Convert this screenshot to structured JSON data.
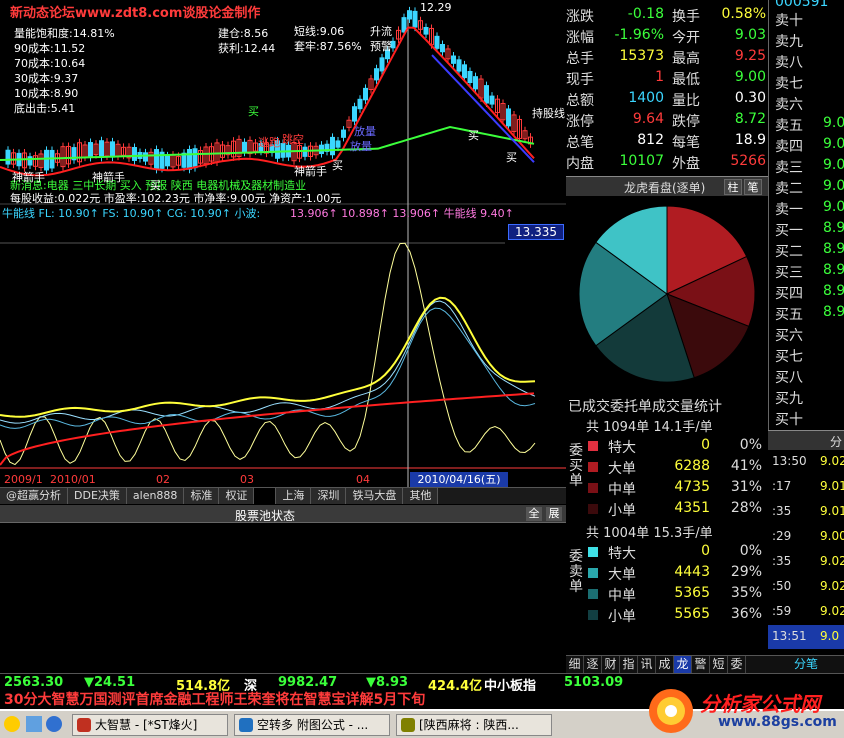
{
  "site_title": "新动态论坛www.zdt8.com谈股论金制作",
  "indicators": {
    "left": [
      "量能饱和度:14.81%",
      "90成本:11.52",
      "70成本:10.64",
      "30成本:9.37",
      "10成本:8.90",
      "底出击:5.41"
    ],
    "jiancang": "建仓:8.56",
    "huoli": "获利:12.44",
    "duanxian": "短线:9.06",
    "taolao": "套牢:87.56%",
    "shengliu": "升流",
    "yujing": "预警",
    "high_label": "12.29",
    "news_line": "新消息:电器 三中长期 买入 预报 陕西 电器机械及器材制造业",
    "pe_line": "每股收益:0.022元 市盈率:102.23元 市净率:9.00元 净资产:1.00元",
    "niuneng_line": "牛能线 FL: 10.90↑ FS: 10.90↑ CG: 10.90↑ 小波:",
    "niuneng_right": "13.906↑ 10.898↑ 13.906↑ 牛能线 9.40↑",
    "price_tag": "13.335",
    "chart_labels": [
      "神箭手",
      "神箭手",
      "买",
      "逃跑",
      "跳空",
      "放量",
      "放量",
      "神箭手",
      "买",
      "买",
      "买",
      "持股线",
      "买"
    ],
    "date_labels": [
      "2009/1",
      "2010/01",
      "02",
      "03",
      "04"
    ],
    "selected_date": "2010/04/16(五)"
  },
  "tabs": [
    "@超赢分析",
    "DDE决策",
    "alen888",
    "标准",
    "权证",
    "上海",
    "深圳",
    "铁马大盘",
    "其他"
  ],
  "pool": {
    "title": "股票池状态",
    "btn_all": "全",
    "btn_expand": "展"
  },
  "quote": [
    {
      "l1": "涨跌",
      "v1": "-0.18",
      "c1": "#3bff3b",
      "l2": "换手",
      "v2": "0.58%",
      "c2": "#ffff3b"
    },
    {
      "l1": "涨幅",
      "v1": "-1.96%",
      "c1": "#3bff3b",
      "l2": "今开",
      "v2": "9.03",
      "c2": "#3bff3b"
    },
    {
      "l1": "总手",
      "v1": "15373",
      "c1": "#ffff3b",
      "l2": "最高",
      "v2": "9.25",
      "c2": "#ff3b3b"
    },
    {
      "l1": "现手",
      "v1": "1",
      "c1": "#ff3b3b",
      "l2": "最低",
      "v2": "9.00",
      "c2": "#3bff3b"
    },
    {
      "l1": "总额",
      "v1": "1400",
      "c1": "#3bd6ff",
      "l2": "量比",
      "v2": "0.30",
      "c2": "#ffffff"
    },
    {
      "l1": "涨停",
      "v1": "9.64",
      "c1": "#ff3b3b",
      "l2": "跌停",
      "v2": "8.72",
      "c2": "#3bff3b"
    },
    {
      "l1": "总笔",
      "v1": "812",
      "c1": "#ffffff",
      "l2": "每笔",
      "v2": "18.9",
      "c2": "#ffffff"
    },
    {
      "l1": "内盘",
      "v1": "10107",
      "c1": "#3bff3b",
      "l2": "外盘",
      "v2": "5266",
      "c2": "#ff3b3b"
    }
  ],
  "dragon": {
    "title": "龙虎看盘(逐单)",
    "btn1": "柱",
    "btn2": "笔"
  },
  "pie": [
    {
      "value": 0.18,
      "color": "#b01c22"
    },
    {
      "value": 0.13,
      "color": "#7a1016"
    },
    {
      "value": 0.14,
      "color": "#3b0a0c"
    },
    {
      "value": 0.2,
      "color": "#133a3a"
    },
    {
      "value": 0.2,
      "color": "#237d80"
    },
    {
      "value": 0.15,
      "color": "#3fc3c6"
    }
  ],
  "stats_title": "已成交委托单成交量统计",
  "buy_flow": {
    "side": "委买单",
    "total": "共 1094单 14.1手/单",
    "rows": [
      {
        "label": "特大",
        "value": "0",
        "pct": "0%",
        "color": "#e03040"
      },
      {
        "label": "大单",
        "value": "6288",
        "pct": "41%",
        "color": "#b01c22"
      },
      {
        "label": "中单",
        "value": "4735",
        "pct": "31%",
        "color": "#7a1016"
      },
      {
        "label": "小单",
        "value": "4351",
        "pct": "28%",
        "color": "#3b0a0c"
      }
    ]
  },
  "sell_flow": {
    "side": "委卖单",
    "total": "共 1004单 15.3手/单",
    "rows": [
      {
        "label": "特大",
        "value": "0",
        "pct": "0%",
        "color": "#3fe0e6"
      },
      {
        "label": "大单",
        "value": "4443",
        "pct": "29%",
        "color": "#2aa8ac"
      },
      {
        "label": "中单",
        "value": "5365",
        "pct": "35%",
        "color": "#1b6e72"
      },
      {
        "label": "小单",
        "value": "5565",
        "pct": "36%",
        "color": "#123f42"
      }
    ]
  },
  "sub_tabs": [
    "细",
    "逐",
    "财",
    "指",
    "讯",
    "成",
    "龙",
    "警",
    "短",
    "委"
  ],
  "book": [
    {
      "label": "卖十",
      "value": ""
    },
    {
      "label": "卖九",
      "value": ""
    },
    {
      "label": "卖八",
      "value": ""
    },
    {
      "label": "卖七",
      "value": ""
    },
    {
      "label": "卖六",
      "value": ""
    },
    {
      "label": "卖五",
      "value": "9.0"
    },
    {
      "label": "卖四",
      "value": "9.0"
    },
    {
      "label": "卖三",
      "value": "9.0"
    },
    {
      "label": "卖二",
      "value": "9.0"
    },
    {
      "label": "卖一",
      "value": "9.0"
    },
    {
      "label": "买一",
      "value": "8.9"
    },
    {
      "label": "买二",
      "value": "8.9"
    },
    {
      "label": "买三",
      "value": "8.9"
    },
    {
      "label": "买四",
      "value": "8.9"
    },
    {
      "label": "买五",
      "value": "8.9"
    },
    {
      "label": "买六",
      "value": ""
    },
    {
      "label": "买七",
      "value": ""
    },
    {
      "label": "买八",
      "value": ""
    },
    {
      "label": "买九",
      "value": ""
    },
    {
      "label": "买十",
      "value": ""
    }
  ],
  "book_header": "000591",
  "tick_header": "分",
  "ticks": [
    {
      "t": "13:50",
      "v": "9.02"
    },
    {
      "t": ":17",
      "v": "9.01"
    },
    {
      "t": ":35",
      "v": "9.01"
    },
    {
      "t": ":29",
      "v": "9.00"
    },
    {
      "t": ":35",
      "v": "9.02"
    },
    {
      "t": ":50",
      "v": "9.02"
    },
    {
      "t": ":59",
      "v": "9.02"
    },
    {
      "t": "13:51",
      "v": "9.0"
    }
  ],
  "tick_footer": "分笔",
  "market": {
    "sh_index": "2563.30",
    "sh_chg": "▼24.51",
    "sh_amt": "514.8亿",
    "sz_label": "深",
    "sz_index": "9982.47",
    "sz_chg": "▼8.93",
    "sz_amt": "424.4亿",
    "zx_label": "中小板指",
    "zx_index": "5103.09"
  },
  "ticker": "30分大智慧万国测评首席金融工程师王荣奎将在智慧宝详解5月下旬",
  "taskbar": [
    {
      "label": "大智慧 - [*ST烽火]",
      "color": "#c03020"
    },
    {
      "label": "空转多 附图公式 - ...",
      "color": "#2070c0"
    },
    {
      "label": "[陕西麻将 : 陕西...",
      "color": "#808000"
    }
  ],
  "logo": {
    "text": "分析家公式网",
    "url": "www.88gs.com"
  }
}
